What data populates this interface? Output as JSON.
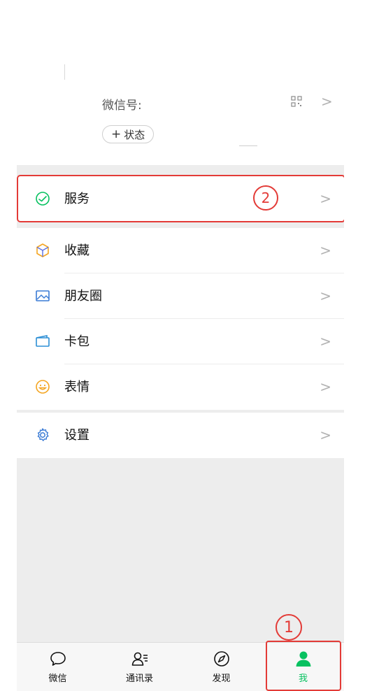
{
  "profile": {
    "wechat_id_label": "微信号:",
    "status_label": "状态",
    "chevron": ">"
  },
  "menu": {
    "service": "服务",
    "favorites": "收藏",
    "moments": "朋友圈",
    "cards": "卡包",
    "stickers": "表情",
    "settings": "设置",
    "chevron": ">"
  },
  "annotations": {
    "step1": "1",
    "step2": "2",
    "color": "#e33b37"
  },
  "tabbar": {
    "chats": "微信",
    "contacts": "通讯录",
    "discover": "发现",
    "me": "我",
    "active_color": "#07c160"
  },
  "icons": {
    "service": "service-icon",
    "favorites": "cube-icon",
    "moments": "image-icon",
    "cards": "card-wallet-icon",
    "stickers": "smiley-icon",
    "settings": "gear-icon",
    "qr": "qr-code-icon"
  }
}
